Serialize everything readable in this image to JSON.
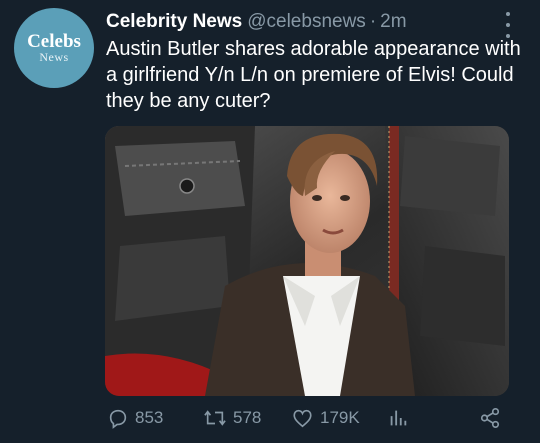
{
  "account": {
    "name": "Celebrity News",
    "handle": "@celebsnews",
    "separator": "·",
    "time": "2m",
    "avatar_text_line1": "Celebs",
    "avatar_text_line2": "News"
  },
  "tweet": {
    "text": "Austin Butler shares adorable appearance with a girlfriend Y/n L/n on premiere of Elvis! Could they be any cuter?"
  },
  "actions": {
    "replies": "853",
    "retweets": "578",
    "likes": "179K"
  },
  "colors": {
    "background": "#15202b",
    "secondary_text": "#8899a6",
    "avatar_bg": "#5b9fb8"
  },
  "icons": [
    "more-vertical-icon",
    "reply-icon",
    "retweet-icon",
    "like-icon",
    "analytics-icon",
    "share-icon"
  ]
}
